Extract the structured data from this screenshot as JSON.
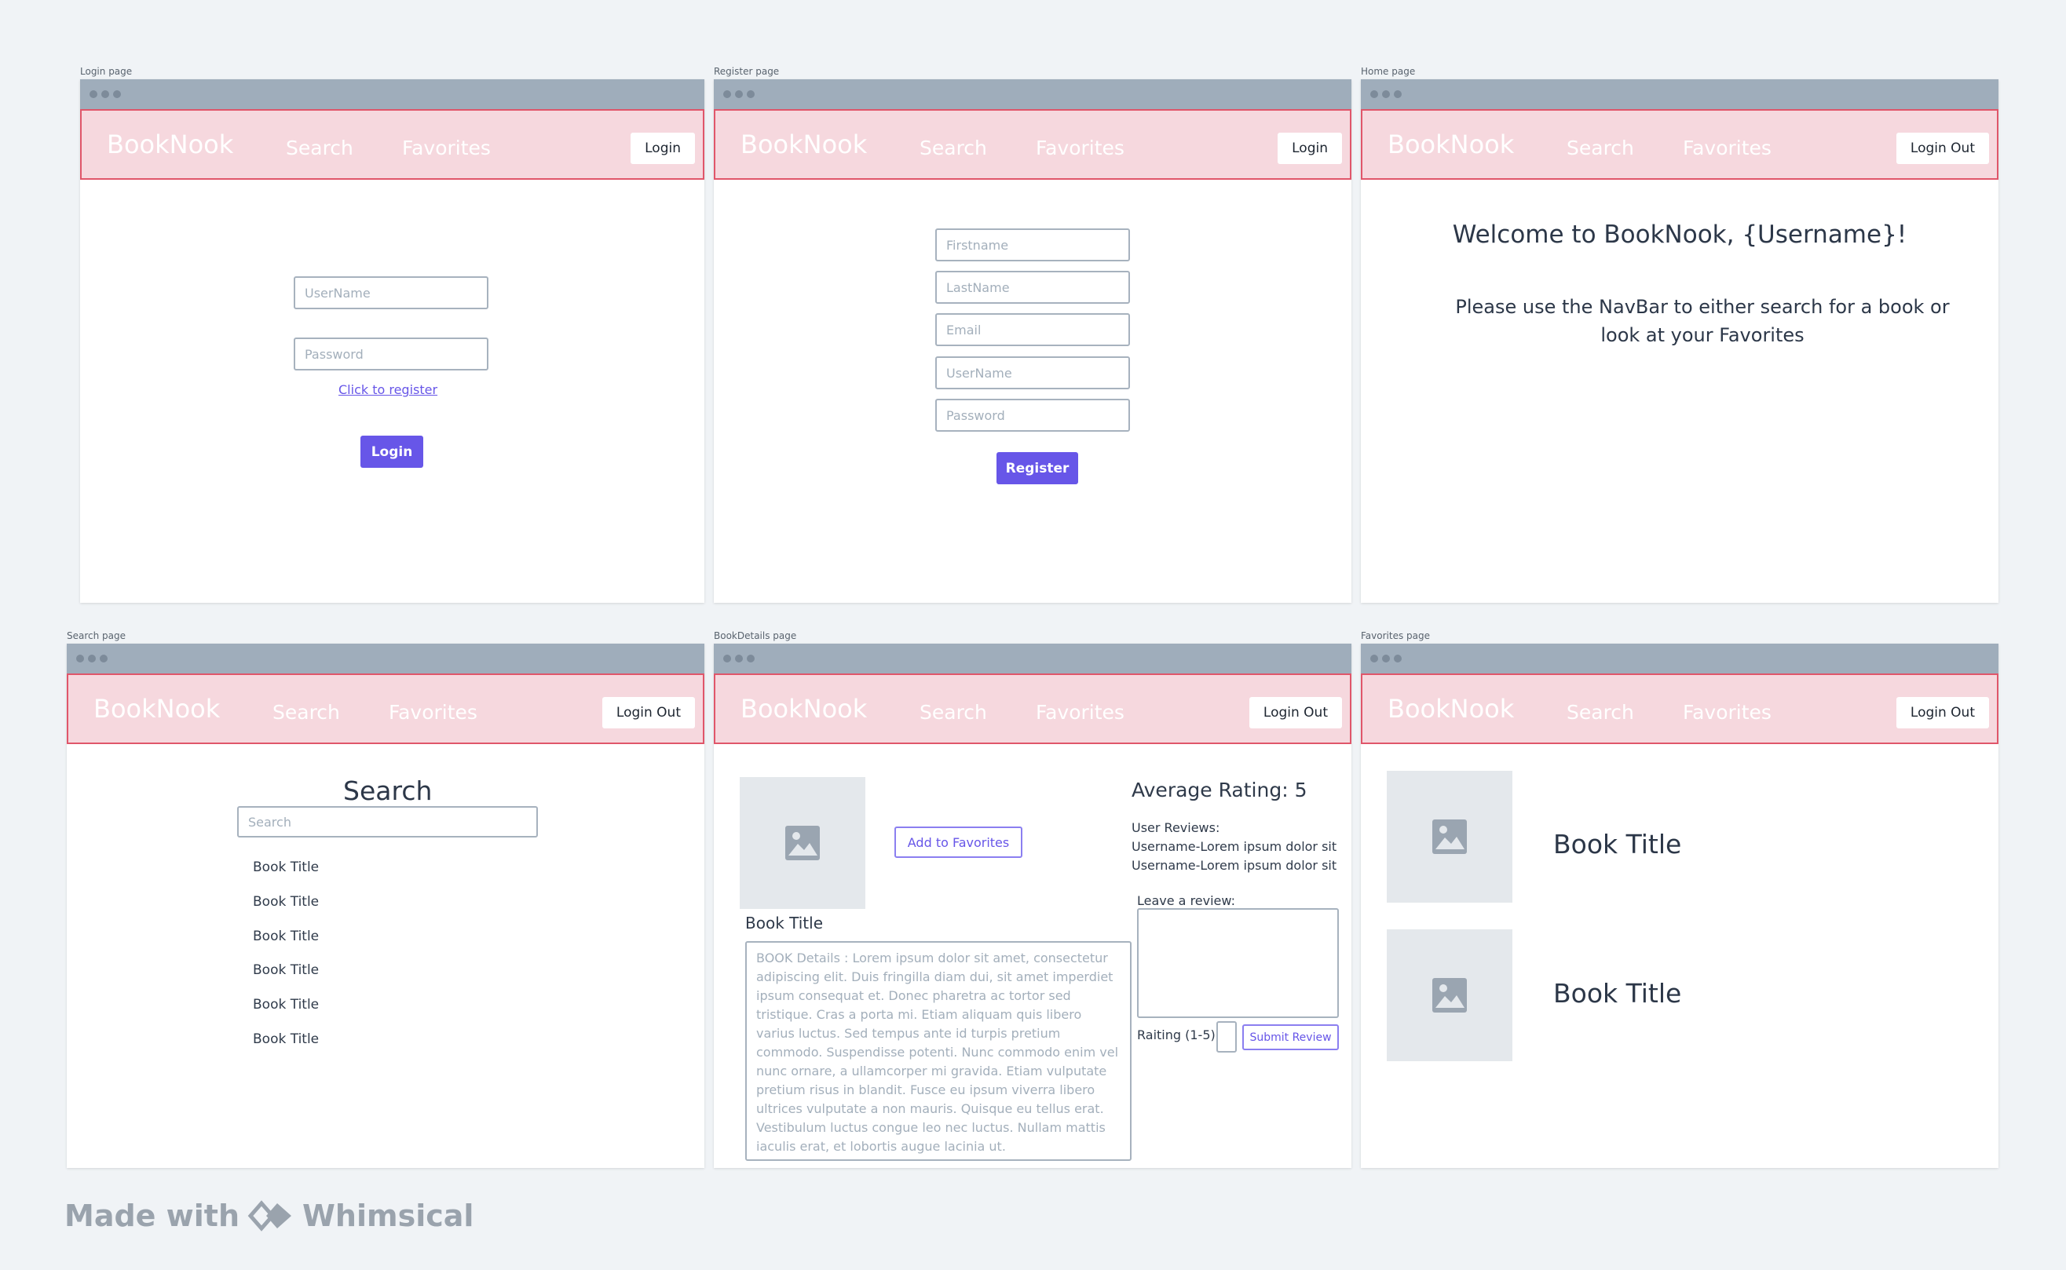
{
  "brand": "BookNook",
  "nav": {
    "search": "Search",
    "favorites": "Favorites",
    "login": "Login",
    "logout": "Login Out"
  },
  "login_page": {
    "label": "Login page",
    "username_placeholder": "UserName",
    "password_placeholder": "Password",
    "register_link": "Click to register",
    "login_button": "Login"
  },
  "register_page": {
    "label": "Register page",
    "fields": [
      "Firstname",
      "LastName",
      "Email",
      "UserName",
      "Password"
    ],
    "register_button": "Register"
  },
  "home_page": {
    "label": "Home page",
    "welcome": "Welcome to BookNook, {Username}!",
    "subtitle": "Please use the NavBar to either search for a book or look at your Favorites"
  },
  "search_page": {
    "label": "Search page",
    "heading": "Search",
    "search_placeholder": "Search",
    "results": [
      "Book Title",
      "Book Title",
      "Book Title",
      "Book Title",
      "Book Title",
      "Book Title"
    ]
  },
  "details_page": {
    "label": "BookDetails page",
    "add_favorites": "Add to Favorites",
    "book_title": "Book Title",
    "book_details": "BOOK Details : Lorem ipsum dolor sit amet, consectetur adipiscing elit. Duis fringilla diam dui, sit amet imperdiet ipsum consequat et. Donec pharetra ac tortor sed tristique. Cras a porta mi. Etiam aliquam quis libero varius luctus. Sed tempus ante id turpis pretium commodo. Suspendisse potenti. Nunc commodo enim vel nunc ornare, a ullamcorper mi gravida. Etiam vulputate pretium risus in blandit. Fusce eu ipsum viverra libero ultrices vulputate a non mauris. Quisque eu tellus erat. Vestibulum luctus congue leo nec luctus. Nullam mattis iaculis erat, et lobortis augue lacinia ut.",
    "average_rating": "Average Rating: 5",
    "user_reviews_label": "User Reviews:",
    "reviews": [
      "Username-Lorem ipsum dolor sit",
      "Username-Lorem ipsum dolor sit"
    ],
    "leave_review": "Leave a review:",
    "rating_label": "Raiting (1-5)",
    "submit_review": "Submit Review"
  },
  "favorites_page": {
    "label": "Favorites page",
    "books": [
      "Book Title",
      "Book Title"
    ]
  },
  "footer": {
    "made_with": "Made with",
    "brand": "Whimsical"
  },
  "colors": {
    "navbar_bg": "#f6d8de",
    "navbar_border": "#e0566a",
    "accent": "#6756e8",
    "titlebar": "#9fadbb"
  }
}
